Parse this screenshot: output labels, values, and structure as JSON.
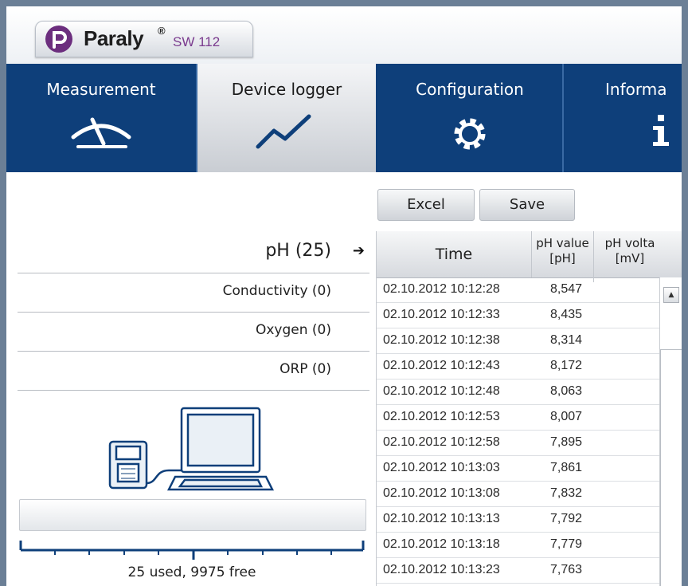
{
  "app": {
    "brand": "Paraly",
    "brand_reg": "®",
    "model": "SW 112"
  },
  "tabs": [
    {
      "label": "Measurement",
      "icon": "gauge-icon",
      "active": false
    },
    {
      "label": "Device logger",
      "icon": "trend-icon",
      "active": true
    },
    {
      "label": "Configuration",
      "icon": "gear-icon",
      "active": false
    },
    {
      "label": "Informa",
      "icon": "info-icon",
      "active": false
    }
  ],
  "channels": [
    {
      "label": "pH (25)",
      "active": true,
      "arrow": "➔"
    },
    {
      "label": "Conductivity (0)",
      "active": false
    },
    {
      "label": "Oxygen (0)",
      "active": false
    },
    {
      "label": "ORP (0)",
      "active": false
    }
  ],
  "illustration": {
    "icon": "device-to-computer-icon"
  },
  "storage": {
    "text": "25 used, 9975 free",
    "used": 25,
    "free": 9975
  },
  "toolbar": {
    "excel_label": "Excel",
    "save_label": "Save"
  },
  "table": {
    "headers": {
      "time": "Time",
      "ph_line1": "pH value",
      "ph_line2": "[pH]",
      "mv_line1": "pH volta",
      "mv_line2": "[mV]"
    },
    "rows": [
      {
        "time": "02.10.2012 10:12:28",
        "ph": "8,547"
      },
      {
        "time": "02.10.2012 10:12:33",
        "ph": "8,435"
      },
      {
        "time": "02.10.2012 10:12:38",
        "ph": "8,314"
      },
      {
        "time": "02.10.2012 10:12:43",
        "ph": "8,172"
      },
      {
        "time": "02.10.2012 10:12:48",
        "ph": "8,063"
      },
      {
        "time": "02.10.2012 10:12:53",
        "ph": "8,007"
      },
      {
        "time": "02.10.2012 10:12:58",
        "ph": "7,895"
      },
      {
        "time": "02.10.2012 10:13:03",
        "ph": "7,861"
      },
      {
        "time": "02.10.2012 10:13:08",
        "ph": "7,832"
      },
      {
        "time": "02.10.2012 10:13:13",
        "ph": "7,792"
      },
      {
        "time": "02.10.2012 10:13:18",
        "ph": "7,779"
      },
      {
        "time": "02.10.2012 10:13:23",
        "ph": "7,763"
      }
    ],
    "scroll_up": "▲"
  },
  "colors": {
    "nav_bg": "#0e3f7a",
    "brand_purple": "#6c2e7e",
    "outer_bg": "#6b7f96"
  }
}
